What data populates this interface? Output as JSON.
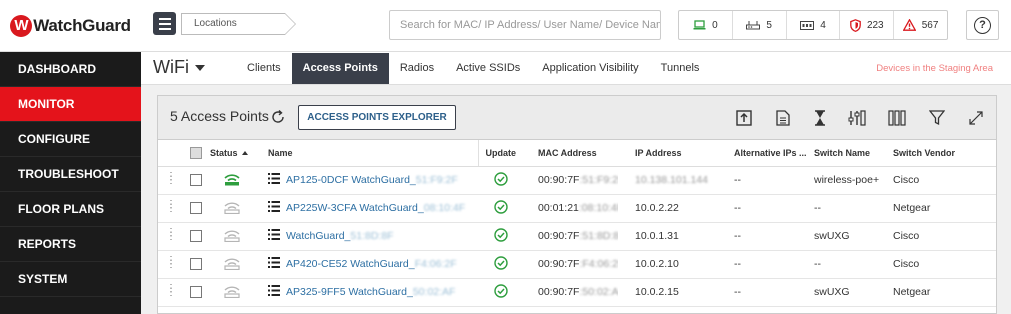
{
  "brand": {
    "logo_text": "WatchGuard",
    "accent": "#e4131b",
    "sidebar_bg": "#1b1b1b"
  },
  "sidebar": {
    "items": [
      {
        "label": "DASHBOARD"
      },
      {
        "label": "MONITOR"
      },
      {
        "label": "CONFIGURE"
      },
      {
        "label": "TROUBLESHOOT"
      },
      {
        "label": "FLOOR PLANS"
      },
      {
        "label": "REPORTS"
      },
      {
        "label": "SYSTEM"
      }
    ],
    "active_index": 1
  },
  "header": {
    "breadcrumb": "Locations",
    "search_placeholder": "Search for MAC/ IP Address/ User Name/ Device Name...",
    "stats": [
      {
        "icon": "laptop-icon",
        "value": "0",
        "color": "#2e9e3e"
      },
      {
        "icon": "router-icon",
        "value": "5",
        "color": "#444"
      },
      {
        "icon": "switch-icon",
        "value": "4",
        "color": "#444"
      },
      {
        "icon": "shield-icon",
        "value": "223",
        "color": "#d9191f"
      },
      {
        "icon": "warning-icon",
        "value": "567",
        "color": "#d9191f"
      }
    ],
    "help_label": "?"
  },
  "subnav": {
    "title": "WiFi",
    "tabs": [
      {
        "label": "Clients"
      },
      {
        "label": "Access Points"
      },
      {
        "label": "Radios"
      },
      {
        "label": "Active SSIDs"
      },
      {
        "label": "Application Visibility"
      },
      {
        "label": "Tunnels"
      }
    ],
    "active_tab": 1,
    "staging_link": "Devices in the Staging Area"
  },
  "panel": {
    "title": "5 Access Points",
    "explorer_button": "ACCESS POINTS EXPLORER",
    "tools": [
      "export-icon",
      "report-icon",
      "hourglass-icon",
      "filter-settings-icon",
      "columns-icon",
      "filter-icon",
      "expand-icon"
    ]
  },
  "table": {
    "headers": {
      "status": "Status",
      "name": "Name",
      "update": "Update",
      "mac": "MAC Address",
      "ip": "IP Address",
      "alt_ips": "Alternative IPs ...",
      "switch_name": "Switch Name",
      "switch_vendor": "Switch Vendor"
    },
    "rows": [
      {
        "status": "online",
        "name": "AP125-0DCF WatchGuard_",
        "name_blur": "51:F9:2F",
        "mac": "00:90:7F",
        "mac_blur": ":51:F9:2F",
        "ip": "10.138.101.144",
        "ip_blurred": true,
        "alt_ips": "--",
        "switch_name": "wireless-poe+",
        "switch_vendor": "Cisco"
      },
      {
        "status": "offline",
        "name": "AP225W-3CFA WatchGuard_",
        "name_blur": "08:10:4F",
        "mac": "00:01:21",
        "mac_blur": ":08:10:4F",
        "ip": "10.0.2.22",
        "ip_blurred": false,
        "alt_ips": "--",
        "switch_name": "--",
        "switch_vendor": "Netgear"
      },
      {
        "status": "offline",
        "name": "WatchGuard_",
        "name_blur": "51:8D:8F",
        "mac": "00:90:7F",
        "mac_blur": ":51:8D:8F",
        "ip": "10.0.1.31",
        "ip_blurred": false,
        "alt_ips": "--",
        "switch_name": "swUXG",
        "switch_vendor": "Cisco"
      },
      {
        "status": "offline",
        "name": "AP420-CE52 WatchGuard_",
        "name_blur": "F4:06:2F",
        "mac": "00:90:7F",
        "mac_blur": ":F4:06:2F",
        "ip": "10.0.2.10",
        "ip_blurred": false,
        "alt_ips": "--",
        "switch_name": "--",
        "switch_vendor": "Cisco"
      },
      {
        "status": "offline",
        "name": "AP325-9FF5 WatchGuard_",
        "name_blur": "50:02:AF",
        "mac": "00:90:7F",
        "mac_blur": ":50:02:AF",
        "ip": "10.0.2.15",
        "ip_blurred": false,
        "alt_ips": "--",
        "switch_name": "swUXG",
        "switch_vendor": "Netgear"
      }
    ]
  }
}
